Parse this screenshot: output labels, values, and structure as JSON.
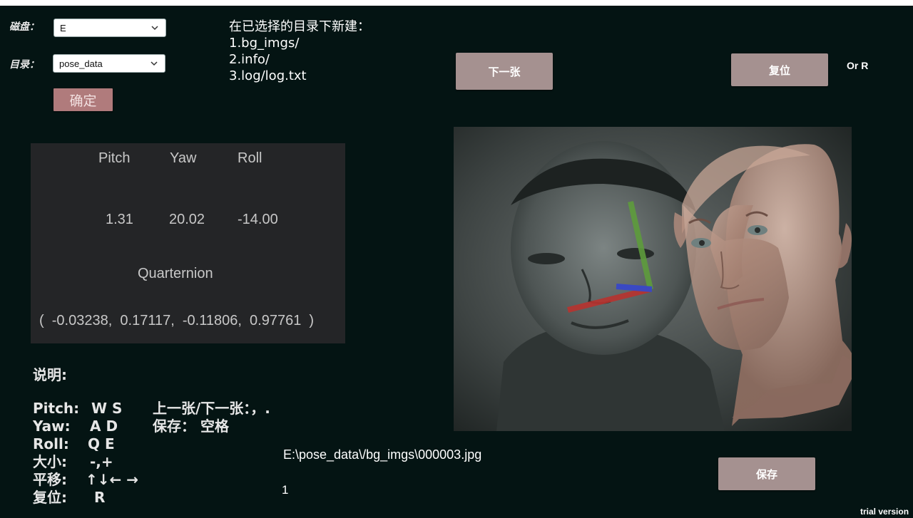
{
  "disk": {
    "label": "磁盘：",
    "value": "E"
  },
  "directory": {
    "label": "目录：",
    "value": "pose_data"
  },
  "confirm_label": "确定",
  "create_info": {
    "heading": "在已选择的目录下新建：",
    "lines": [
      "1.bg_imgs/",
      "2.info/",
      "3.log/log.txt"
    ]
  },
  "next_label": "下一张",
  "reset_label": "复位",
  "or_r_label": "Or R",
  "save_label": "保存",
  "pose": {
    "headers": [
      "Pitch",
      "Yaw",
      "Roll"
    ],
    "values": [
      "1.31",
      "20.02",
      "-14.00"
    ],
    "quat_label": "Quarternion",
    "quaternion": "(  -0.03238,  0.17117,  -0.11806,  0.97761  )"
  },
  "help": {
    "title": "说明:",
    "rows": [
      {
        "key": "Pitch:",
        "val": "W S"
      },
      {
        "key": "Yaw:",
        "val": "A  D"
      },
      {
        "key": "Roll:",
        "val": "Q  E"
      },
      {
        "key": "大小:",
        "val": "-,+"
      },
      {
        "key": "平移:",
        "val": "↑↓← →"
      },
      {
        "key": "复位:",
        "val": "R"
      }
    ],
    "extra": [
      "上一张/下一张：，.",
      "保存：  空格"
    ]
  },
  "file_path": "E:\\pose_data\\/bg_imgs\\000003.jpg",
  "counter": "1",
  "trial_label": "trial version",
  "colors": {
    "background": "#041413",
    "button": "#a59190",
    "confirm": "#b07b7c",
    "panel": "#242527",
    "axis_green": "#5a9a3a",
    "axis_red": "#b8332f",
    "axis_blue": "#3848c8"
  }
}
